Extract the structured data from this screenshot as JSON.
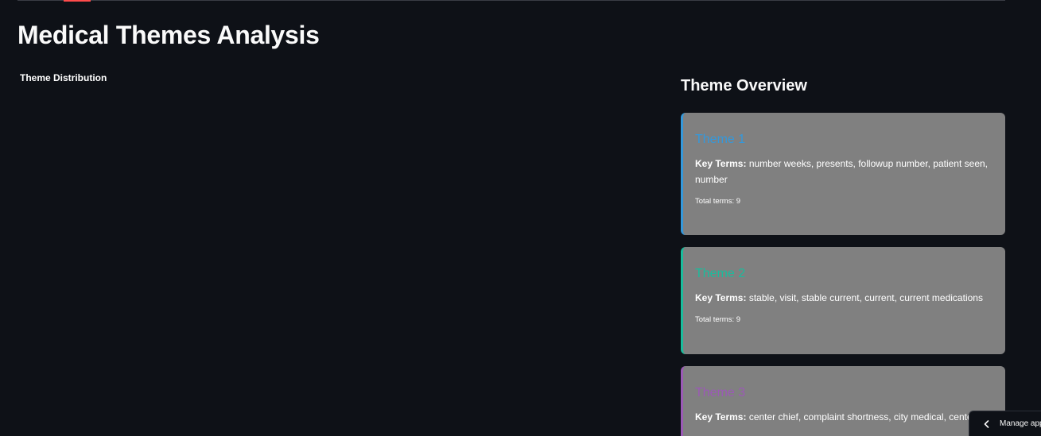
{
  "page": {
    "title": "Medical Themes Analysis"
  },
  "chart": {
    "title": "Theme Distribution"
  },
  "overview": {
    "heading": "Theme Overview",
    "key_terms_label": "Key Terms:",
    "cards": [
      {
        "name": "Theme 1",
        "accent_color": "#3498db",
        "key_terms": "number weeks, presents, followup number, patient seen, number",
        "total_terms": "Total terms: 9"
      },
      {
        "name": "Theme 2",
        "accent_color": "#1abc9c",
        "key_terms": "stable, visit, stable current, current, current medications",
        "total_terms": "Total terms: 9"
      },
      {
        "name": "Theme 3",
        "accent_color": "#9b59b6",
        "key_terms": "center chief, complaint shortness, city medical, center, city"
      }
    ]
  },
  "footer": {
    "manage_app_label": "Manage app",
    "manage_app_icon": "chevron-left-icon"
  },
  "colors": {
    "background": "#0e1117",
    "card_background": "#808080",
    "tab_accent": "#ff4b4b"
  }
}
